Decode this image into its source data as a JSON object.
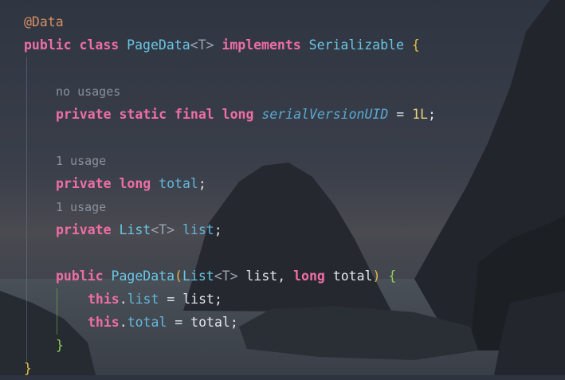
{
  "code": {
    "annotation": "@Data",
    "class_decl": {
      "public": "public",
      "class": "class",
      "name": "PageData",
      "lt": "<",
      "type_param": "T",
      "gt": ">",
      "implements": "implements",
      "iface": "Serializable",
      "open": "{"
    },
    "hint_no_usages": "no usages",
    "serial": {
      "private": "private",
      "static": "static",
      "final": "final",
      "long": "long",
      "name": "serialVersionUID",
      "eq": "=",
      "value": "1L",
      "semi": ";"
    },
    "hint_total": "1 usage",
    "total_decl": {
      "private": "private",
      "long": "long",
      "name": "total",
      "semi": ";"
    },
    "hint_list": "1 usage",
    "list_decl": {
      "private": "private",
      "type": "List",
      "lt": "<",
      "tp": "T",
      "gt": ">",
      "name": "list",
      "semi": ";"
    },
    "ctor": {
      "public": "public",
      "name": "PageData",
      "paren_open": "(",
      "type": "List",
      "lt": "<",
      "tp": "T",
      "gt": ">",
      "p1": "list",
      "comma": ",",
      "long": "long",
      "p2": "total",
      "paren_close": ")",
      "open": "{"
    },
    "assign1": {
      "this": "this",
      "dot": ".",
      "field": "list",
      "eq": "=",
      "value": "list",
      "semi": ";"
    },
    "assign2": {
      "this": "this",
      "dot": ".",
      "field": "total",
      "eq": "=",
      "value": "total",
      "semi": ";"
    },
    "ctor_close": "}",
    "class_close": "}"
  }
}
